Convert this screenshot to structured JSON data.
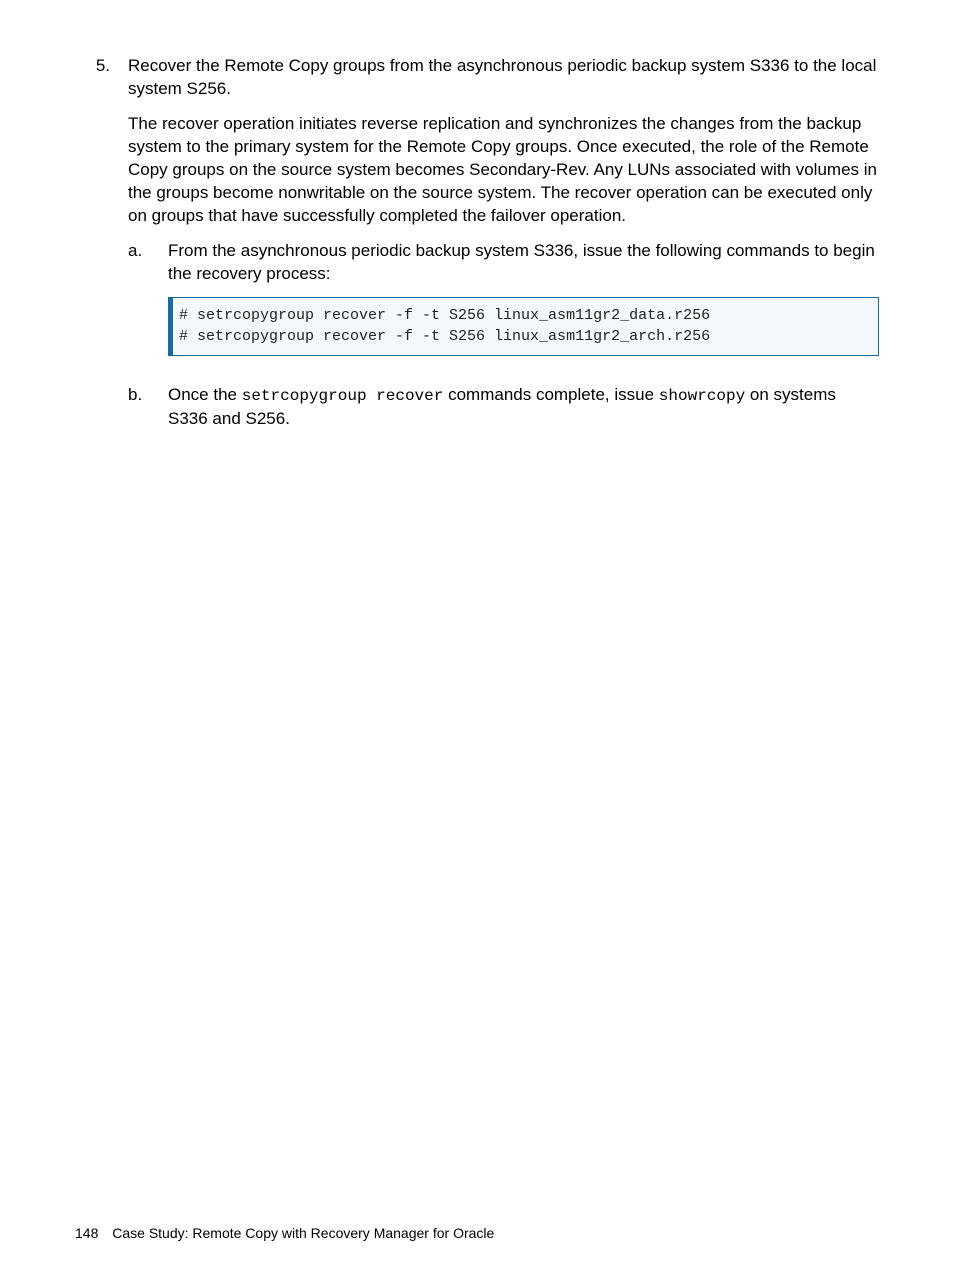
{
  "step": {
    "number": "5.",
    "p1": "Recover the Remote Copy groups from the asynchronous periodic backup system S336 to the local system S256.",
    "p2": "The recover operation initiates reverse replication and synchronizes the changes from the backup system to the primary system for the Remote Copy groups. Once executed, the role of the Remote Copy groups on the source system becomes Secondary-Rev. Any LUNs associated with volumes in the groups become nonwritable on the source system. The recover operation can be executed only on groups that have successfully completed the failover operation."
  },
  "sub_a": {
    "label": "a.",
    "text": "From the asynchronous periodic backup system S336, issue the following commands to begin the recovery process:",
    "code": "# setrcopygroup recover -f -t S256 linux_asm11gr2_data.r256\n# setrcopygroup recover -f -t S256 linux_asm11gr2_arch.r256"
  },
  "sub_b": {
    "label": "b.",
    "pre1": "Once the ",
    "cmd1": "setrcopygroup recover",
    "mid1": " commands complete, issue ",
    "cmd2": "showrcopy",
    "post1": " on systems S336 and S256."
  },
  "footer": {
    "page": "148",
    "title": "Case Study: Remote Copy with Recovery Manager for Oracle"
  }
}
